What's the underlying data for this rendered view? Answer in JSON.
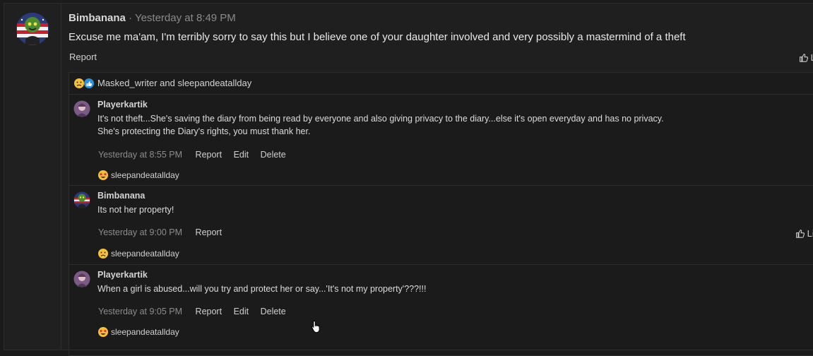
{
  "post": {
    "author": "Bimbanana",
    "separator": "·",
    "time": "Yesterday at 8:49 PM",
    "body": "Excuse me ma'am, I'm terribly sorry to say this but I believe one of your daughter involved and very possibly a mastermind of a theft",
    "report": "Report",
    "like": "Li"
  },
  "reactions": {
    "users": "Masked_writer and sleepandeatallday",
    "icons": [
      "sad-emoji-icon",
      "like-thumb-icon"
    ]
  },
  "comments": [
    {
      "author": "Playerkartik",
      "lines": [
        "It's not theft...She's saving the diary from being read by everyone and also giving privacy to the diary...else it's open everyday and has no privacy.",
        "She's protecting the Diary's rights, you must thank her."
      ],
      "time": "Yesterday at 8:55 PM",
      "actions": [
        "Report",
        "Edit",
        "Delete"
      ],
      "reaction_user": "sleepandeatallday",
      "reaction_icon": "star-eyes-emoji-icon"
    },
    {
      "author": "Bimbanana",
      "lines": [
        "Its not her property!"
      ],
      "time": "Yesterday at 9:00 PM",
      "actions": [
        "Report"
      ],
      "like": "Li",
      "reaction_user": "sleepandeatallday",
      "reaction_icon": "sad-emoji-icon"
    },
    {
      "author": "Playerkartik",
      "lines": [
        "When a girl is abused...will you try and protect her or say...'It's not my property'???!!!"
      ],
      "time": "Yesterday at 9:05 PM",
      "actions": [
        "Report",
        "Edit",
        "Delete"
      ],
      "reaction_user": "sleepandeatallday",
      "reaction_icon": "star-eyes-emoji-icon"
    }
  ]
}
